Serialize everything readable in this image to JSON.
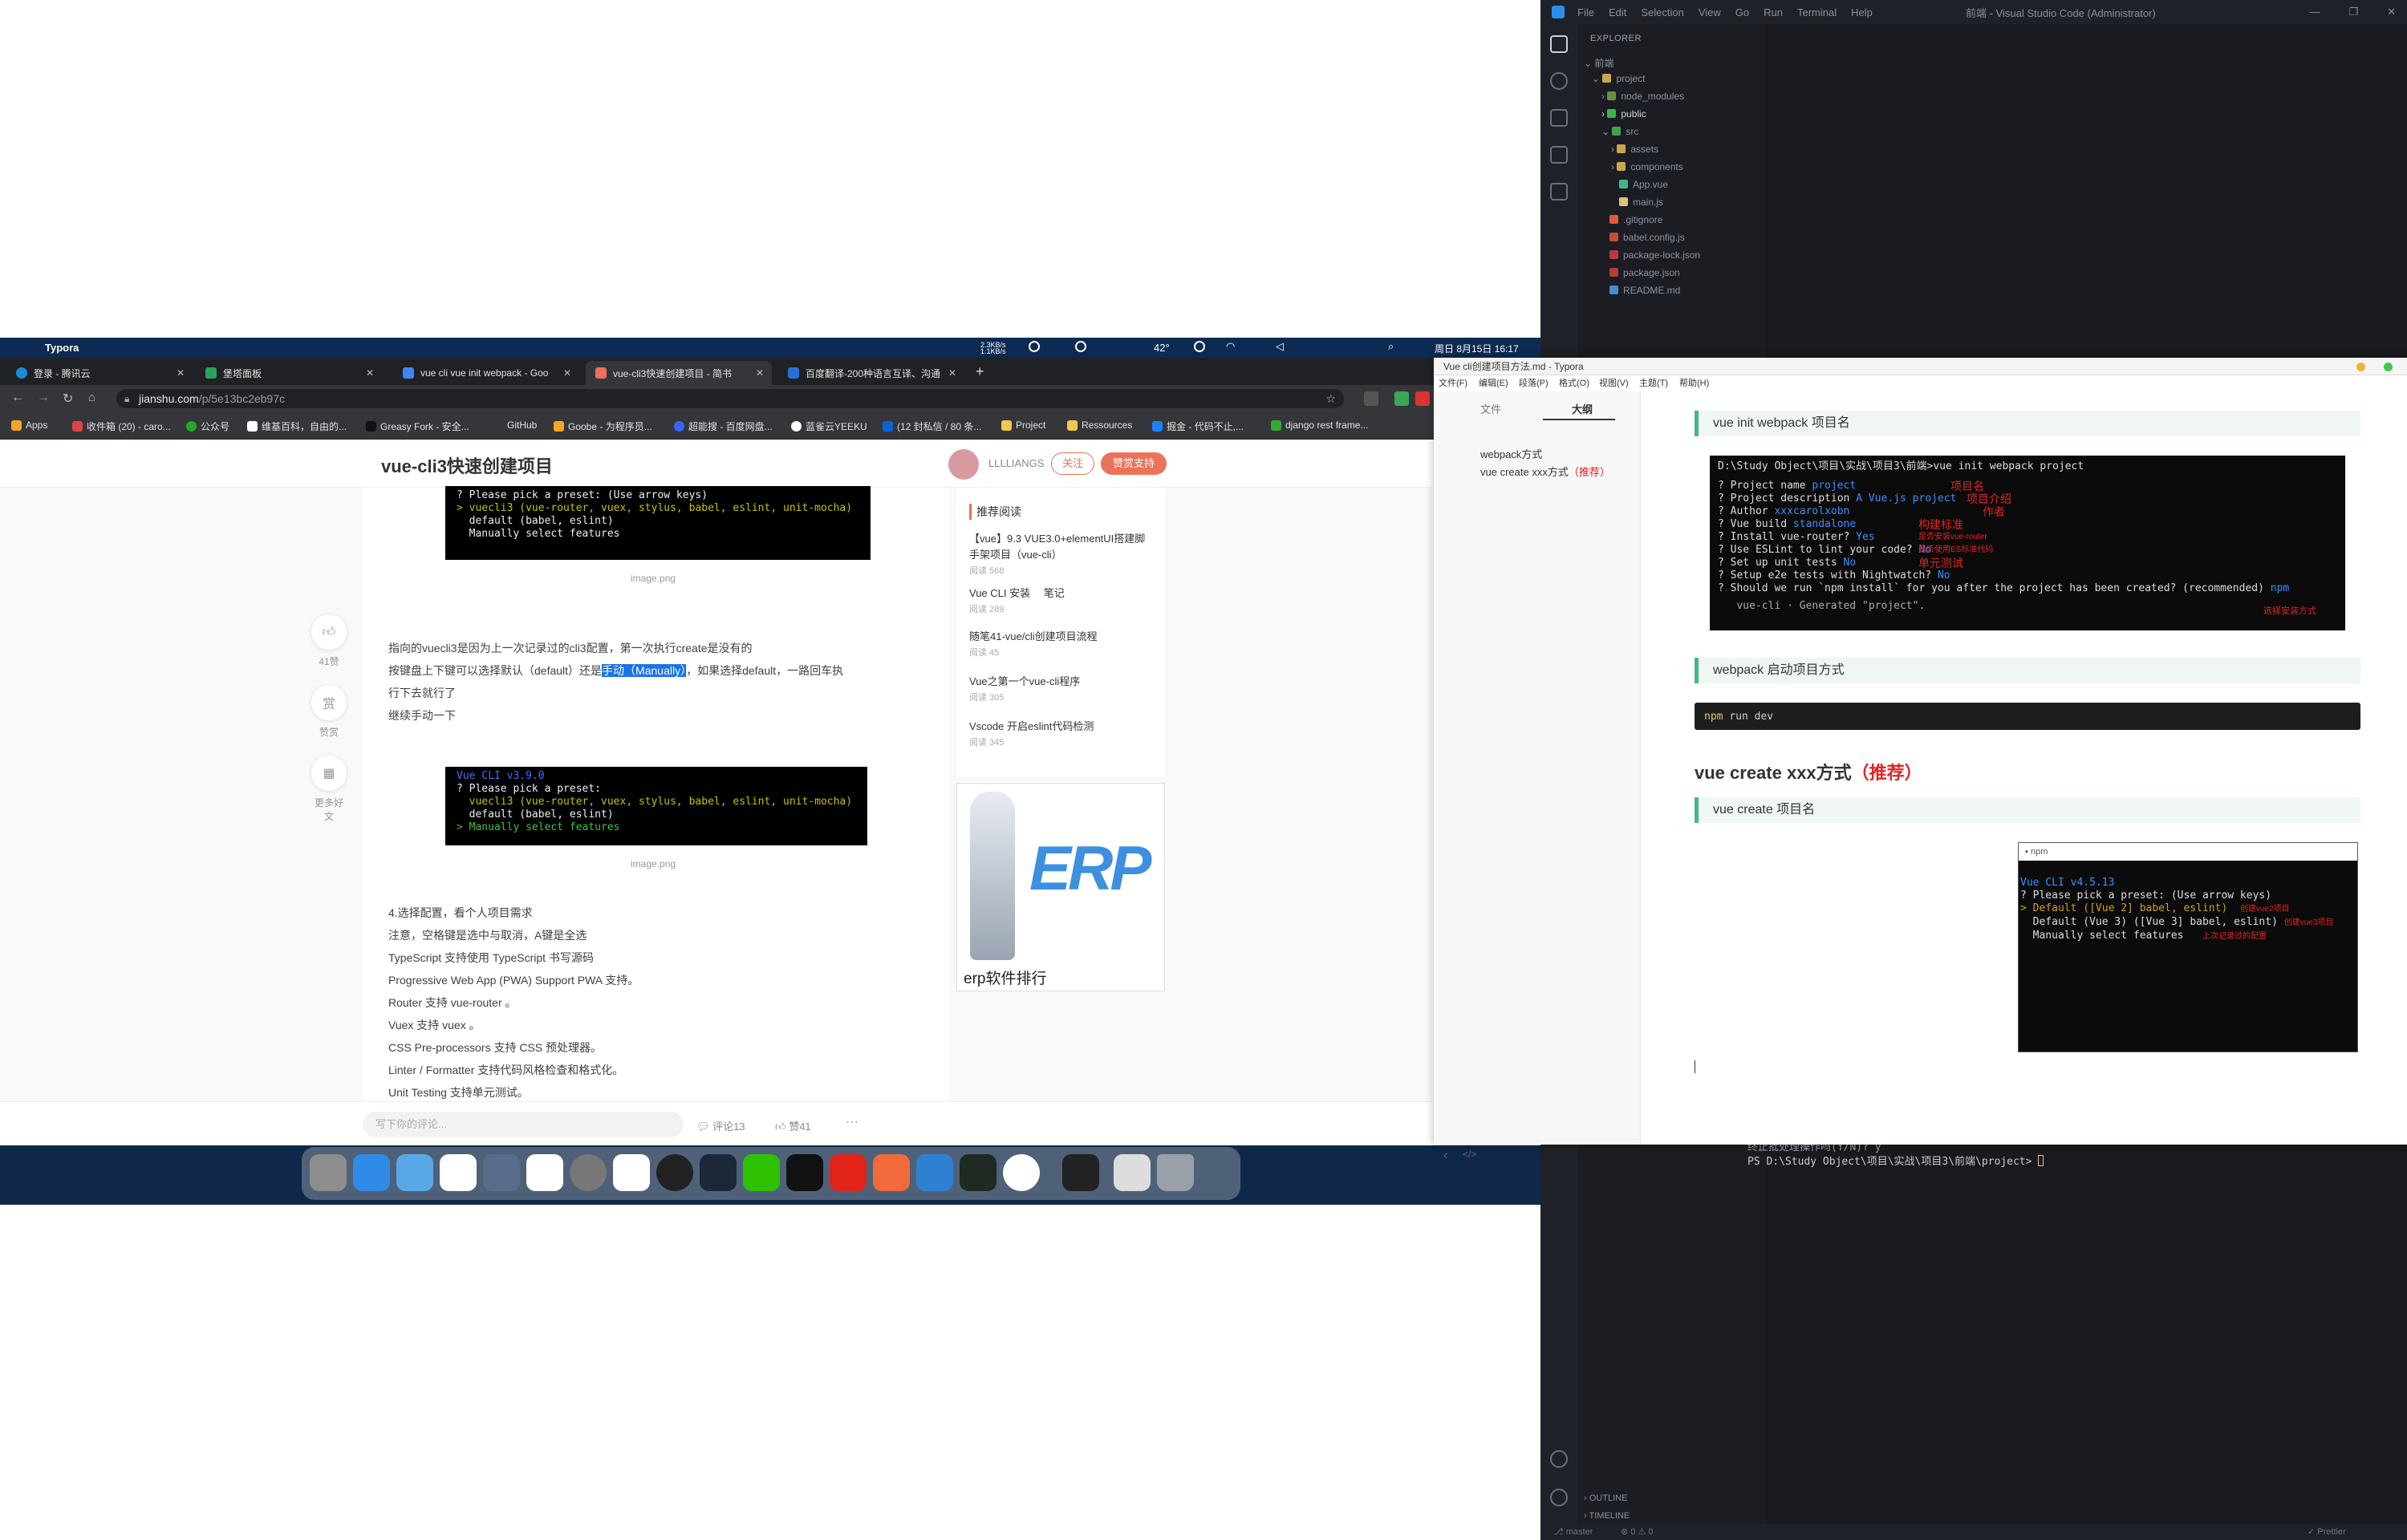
{
  "vscode": {
    "menu": [
      "File",
      "Edit",
      "Selection",
      "View",
      "Go",
      "Run",
      "Terminal",
      "Help"
    ],
    "window_title": "前端 - Visual Studio Code (Administrator)",
    "explorer_title": "EXPLORER",
    "root": "前端",
    "tree": [
      "project",
      "node_modules",
      "public",
      "src",
      "assets",
      "components",
      "App.vue",
      "main.js",
      ".gitignore",
      "babel.config.js",
      "package-lock.json",
      "package.json",
      "README.md"
    ],
    "terminal_line1": "PS D:\\Study Object\\项目\\实战\\项目3\\前端\\project> ",
    "terminal_line0": "终止批处理操作吗(Y/N)? y",
    "outline": "OUTLINE",
    "timeline": "TIMELINE",
    "status_branch": "master",
    "status_errors": "⊗ 0 ⚠ 0",
    "status_prettier": "✓ Prettier"
  },
  "mac": {
    "app": "Typora",
    "menu_status": "2.3KB/s 1.1KB/s",
    "temp": "42°",
    "clock": "周日 8月15日 16:17"
  },
  "chrome": {
    "tabs": [
      "登录 - 腾讯云",
      "堡塔面板",
      "vue cli vue init webpack - Goo",
      "vue-cli3快速创建项目 - 简书",
      "百度翻译-200种语言互译、沟通"
    ],
    "url_host": "jianshu.com",
    "url_path": "/p/5e13bc2eb97c",
    "bookmarks": [
      "Apps",
      "收件箱 (20) - caro...",
      "公众号",
      "维基百科，自由的...",
      "Greasy Fork - 安全...",
      "GitHub",
      "Goobe - 为程序员...",
      "超能搜 - 百度网盘...",
      "蓝雀云YEEKU",
      "(12 封私信 / 80 条...",
      "Project",
      "Ressources",
      "掘金 - 代码不止,...",
      "django rest frame..."
    ]
  },
  "jianshu": {
    "title": "vue-cli3快速创建项目",
    "author": "LLLLIANGS",
    "follow": "关注",
    "support": "赞赏支持",
    "term1": [
      "? Please pick a preset: (Use arrow keys)",
      "> vuecli3 (vue-router, vuex, stylus, babel, eslint, unit-mocha)",
      "  default (babel, eslint)",
      "  Manually select features"
    ],
    "caption": "image.png",
    "para1": "指向的vuecli3是因为上一次记录过的cli3配置，第一次执行create是没有的",
    "para2a": "按键盘上下键可以选择默认（default）还是",
    "para2hl": "手动（Manually）",
    "para2b": "，如果选择default，一路回车执",
    "para3": "行下去就行了",
    "para4": "继续手动一下",
    "term2": [
      "Vue CLI v3.9.0",
      "? Please pick a preset:",
      "  vuecli3 (vue-router, vuex, stylus, babel, eslint, unit-mocha)",
      "  default (babel, eslint)",
      "> Manually select features"
    ],
    "list": [
      "4.选择配置，看个人项目需求",
      "注意，空格键是选中与取消，A键是全选",
      "TypeScript 支持使用 TypeScript 书写源码",
      "Progressive Web App (PWA) Support PWA 支持。",
      "Router 支持 vue-router 。",
      "Vuex 支持 vuex 。",
      "CSS Pre-processors 支持 CSS 预处理器。",
      "Linter / Formatter 支持代码风格检查和格式化。",
      "Unit Testing 支持单元测试。"
    ],
    "like_count": "41赞",
    "reward": "赞赏",
    "more": "更多好文",
    "rec_title": "推荐阅读",
    "rec": [
      {
        "t": "【vue】9.3 VUE3.0+elementUI搭建脚手架项目（vue-cli）",
        "r": "阅读 568"
      },
      {
        "t": "Vue CLI 安装　 笔记",
        "r": "阅读 289"
      },
      {
        "t": "随笔41-vue/cli创建项目流程",
        "r": "阅读 45"
      },
      {
        "t": "Vue之第一个vue-cli程序",
        "r": "阅读 305"
      },
      {
        "t": "Vscode 开启eslint代码检测",
        "r": "阅读 345"
      }
    ],
    "ad_label": "erp软件排行",
    "ad_logo": "ERP",
    "comment_placeholder": "写下你的评论...",
    "comments": "评论13",
    "likes": "赞41",
    "more_dots": "···"
  },
  "typora": {
    "title": "Vue cli创建项目方法.md - Typora",
    "menu": [
      "文件(F)",
      "编辑(E)",
      "段落(P)",
      "格式(O)",
      "视图(V)",
      "主题(T)",
      "帮助(H)"
    ],
    "tab_files": "文件",
    "tab_outline": "大纲",
    "outline1": "webpack方式",
    "outline2a": "vue create xxx方式",
    "outline2b": "（推荐）",
    "q1": "vue init webpack 项目名",
    "code_prompt": "D:\\Study Object\\项目\\实战\\项目3\\前端>vue init webpack project",
    "code_lines": [
      {
        "k": "? Project name ",
        "v": "project",
        "n": "项目名"
      },
      {
        "k": "? Project description ",
        "v": "A Vue.js project",
        "n": "项目介绍"
      },
      {
        "k": "? Author ",
        "v": "xxxcarolxobn",
        "n": "作者"
      },
      {
        "k": "? Vue build ",
        "v": "standalone",
        "n": "构建标准"
      },
      {
        "k": "? Install vue-router? ",
        "v": "Yes",
        "n": "是否安装vue-router"
      },
      {
        "k": "? Use ESLint to lint your code? ",
        "v": "No",
        "n": "是否使用ES标准代码"
      },
      {
        "k": "? Set up unit tests ",
        "v": "No",
        "n": "单元测试"
      },
      {
        "k": "? Setup e2e tests with Nightwatch? ",
        "v": "No",
        "n": ""
      },
      {
        "k": "? Should we run `npm install` for you after the project has been created? (recommended) ",
        "v": "npm",
        "n": ""
      }
    ],
    "code_note_last": "选择安装方式",
    "code_generated": "   vue-cli · Generated \"project\".",
    "q2": "webpack 启动项目方式",
    "run_cmd": "npm run dev",
    "h2a": "vue create xxx方式",
    "h2b": "（推荐）",
    "q3": "vue create 项目名",
    "win_title": "npm",
    "npm_lines": [
      "Vue CLI v4.5.13",
      "? Please pick a preset: (Use arrow keys)",
      "> Default ([Vue 2] babel, eslint)",
      "  Default (Vue 3) ([Vue 3] babel, eslint)",
      "  Manually select features"
    ],
    "npm_notes": [
      "创建vue2项目",
      "创建vue3项目",
      "上次记录过的配置"
    ]
  }
}
